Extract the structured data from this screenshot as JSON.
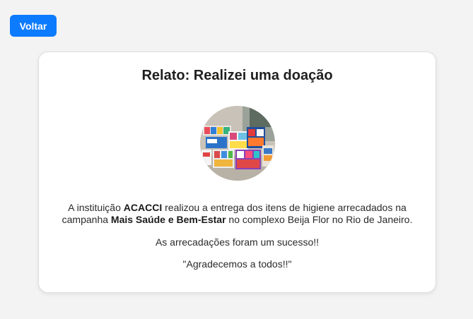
{
  "back_button": {
    "label": "Voltar"
  },
  "card": {
    "title": "Relato: Realizei uma doação",
    "photo_alt": "Itens de higiene arrecadados",
    "paragraph1": {
      "part1": "A instituição ",
      "institution": "ACACCI",
      "part2": " realizou a entrega dos itens de higiene arrecadados na campanha ",
      "campaign": "Mais Saúde e Bem-Estar",
      "part3": " no complexo Beija Flor no Rio de Janeiro."
    },
    "paragraph2": "As arrecadações foram um sucesso!!",
    "paragraph3": "\"Agradecemos a todos!!\""
  },
  "colors": {
    "accent": "#0d7bfd",
    "background": "#f3f3f3",
    "card": "#ffffff"
  }
}
